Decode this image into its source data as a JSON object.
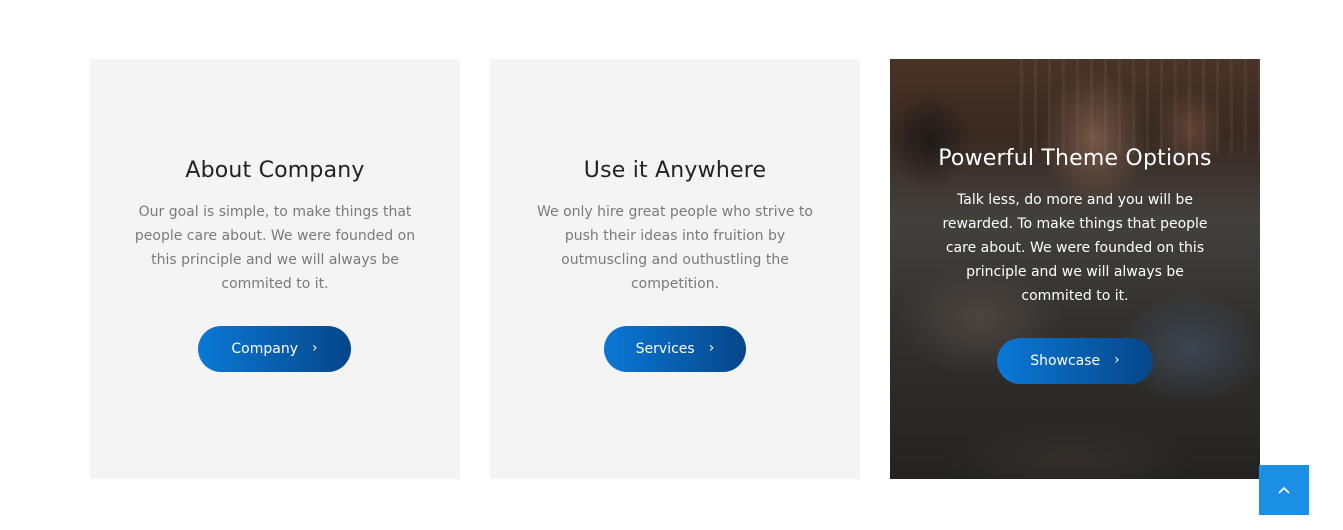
{
  "cards": [
    {
      "title": "About Company",
      "text": "Our goal is simple, to make things that people care about. We were founded on this principle and we will always be commited to it.",
      "button_label": "Company",
      "button_icon": "chevron-right-icon"
    },
    {
      "title": "Use it Anywhere",
      "text": "We only hire great people who strive to push their ideas into fruition by outmuscling and outhustling the competition.",
      "button_label": "Services",
      "button_icon": "chevron-right-icon"
    },
    {
      "title": "Powerful Theme Options",
      "text": "Talk less, do more and you will be rewarded. To make things that people care about. We were founded on this principle and we will always be commited to it.",
      "button_label": "Showcase",
      "button_icon": "chevron-right-icon",
      "background": "photo of people in a meeting"
    }
  ],
  "scroll_top": {
    "icon": "chevron-up-icon"
  },
  "colors": {
    "card_bg": "#f4f4f4",
    "button_gradient_start": "#0a78d6",
    "button_gradient_end": "#06468a",
    "scroll_top_bg": "#1a8fe3",
    "title_color": "#222222",
    "text_color": "#7a7a7a"
  }
}
